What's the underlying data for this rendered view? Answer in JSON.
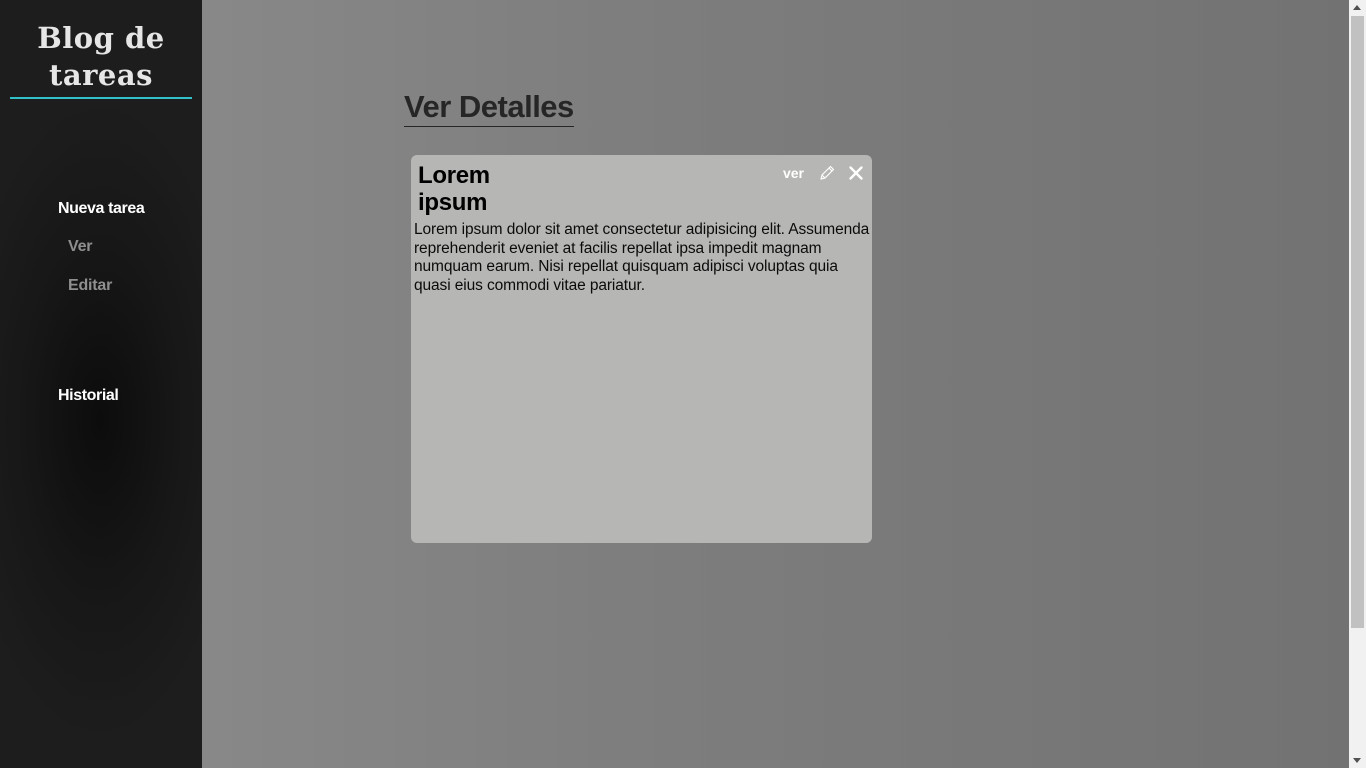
{
  "sidebar": {
    "logo_line1": "Blog de",
    "logo_line2": "tareas",
    "nav": {
      "nueva_tarea": "Nueva tarea",
      "ver": "Ver",
      "editar": "Editar",
      "historial": "Historial"
    }
  },
  "main": {
    "page_title": "Ver Detalles",
    "card": {
      "title_line1": "Lorem",
      "title_line2": "ipsum",
      "ver_label": "ver",
      "edit_icon": "pencil-icon",
      "close_icon": "close-icon",
      "body": "Lorem ipsum dolor sit amet consectetur adipisicing elit. Assumenda reprehenderit eveniet at facilis repellat ipsa impedit magnam numquam earum. Nisi repellat quisquam adipisci voluptas quia quasi eius commodi vitae pariatur."
    }
  },
  "colors": {
    "accent": "#2fc1c7",
    "sidebar_bg": "#1b1b1b",
    "card_bg": "#b6b6b5",
    "nav_active": "#ffffff",
    "nav_muted": "#8f8f8f"
  }
}
